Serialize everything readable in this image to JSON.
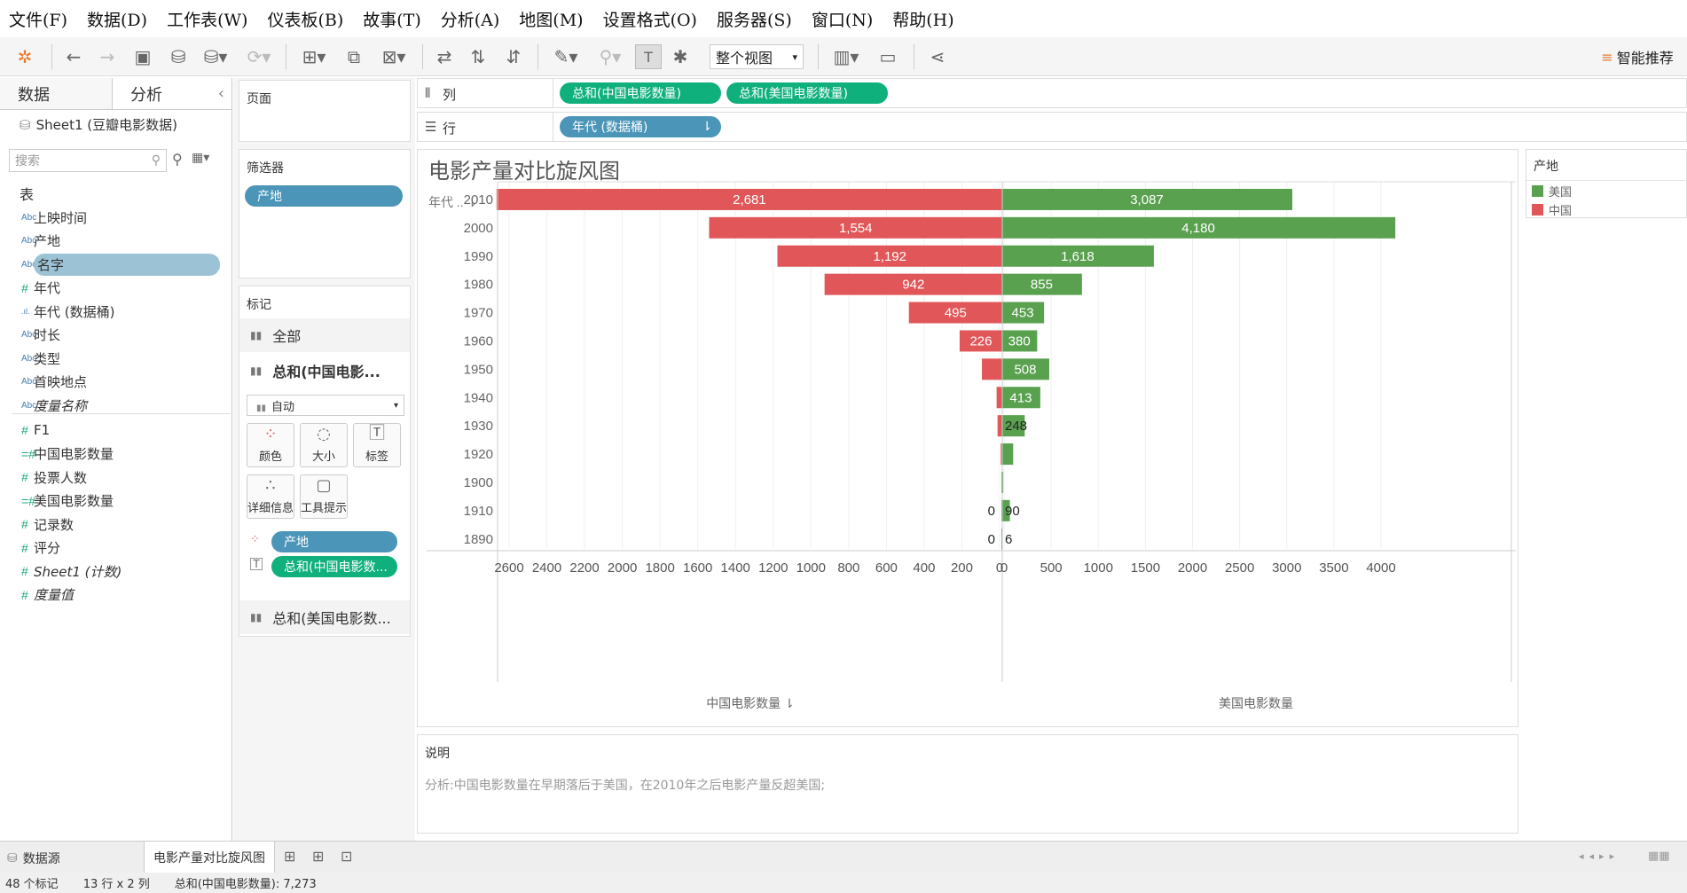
{
  "menu": [
    "文件(F)",
    "数据(D)",
    "工作表(W)",
    "仪表板(B)",
    "故事(T)",
    "分析(A)",
    "地图(M)",
    "设置格式(O)",
    "服务器(S)",
    "窗口(N)",
    "帮助(H)"
  ],
  "toolbar": {
    "view_select": "整个视图",
    "smart_recommend": "智能推荐"
  },
  "left_panel": {
    "tab_data": "数据",
    "tab_analysis": "分析",
    "datasource": "Sheet1 (豆瓣电影数据)",
    "search_placeholder": "搜索",
    "table_header": "表",
    "dimensions": [
      {
        "type": "Abc",
        "name": "上映时间"
      },
      {
        "type": "Abc",
        "name": "产地"
      },
      {
        "type": "Abc",
        "name": "名字"
      },
      {
        "type": "#",
        "name": "年代"
      },
      {
        "type": "bin",
        "name": "年代 (数据桶)"
      },
      {
        "type": "Abc",
        "name": "时长"
      },
      {
        "type": "Abc",
        "name": "类型"
      },
      {
        "type": "Abc",
        "name": "首映地点"
      },
      {
        "type": "Abc",
        "name": "度量名称"
      }
    ],
    "measures": [
      {
        "type": "#",
        "name": "F1"
      },
      {
        "type": "calc",
        "name": "中国电影数量"
      },
      {
        "type": "#",
        "name": "投票人数"
      },
      {
        "type": "calc",
        "name": "美国电影数量"
      },
      {
        "type": "#",
        "name": "记录数"
      },
      {
        "type": "#",
        "name": "评分"
      },
      {
        "type": "#",
        "name": "Sheet1 (计数)"
      },
      {
        "type": "#",
        "name": "度量值"
      }
    ]
  },
  "mid_panel": {
    "pages": "页面",
    "filters": "筛选器",
    "filter_pill": "产地",
    "marks": "标记",
    "marks_all": "全部",
    "marks_cn": "总和(中国电影...",
    "marks_type": "自动",
    "btn_color": "颜色",
    "btn_size": "大小",
    "btn_label": "标签",
    "btn_detail": "详细信息",
    "btn_tooltip": "工具提示",
    "mark_pill_color": "产地",
    "mark_pill_label": "总和(中国电影数...",
    "marks_us": "总和(美国电影数..."
  },
  "shelves": {
    "columns_label": "列",
    "rows_label": "行",
    "col_pill_1": "总和(中国电影数量)",
    "col_pill_2": "总和(美国电影数量)",
    "row_pill": "年代 (数据桶)"
  },
  "legend": {
    "title": "产地",
    "items": [
      {
        "name": "美国",
        "color": "#59a14f"
      },
      {
        "name": "中国",
        "color": "#e15759"
      }
    ]
  },
  "caption": {
    "title": "说明",
    "text": "分析:中国电影数量在早期落后于美国，在2010年之后电影产量反超美国;"
  },
  "chart_data": {
    "type": "bar",
    "title": "电影产量对比旋风图",
    "row_header": "年代 ..",
    "categories": [
      "2010",
      "2000",
      "1990",
      "1980",
      "1970",
      "1960",
      "1950",
      "1940",
      "1930",
      "1920",
      "1900",
      "1910",
      "1890"
    ],
    "series": [
      {
        "name": "中国",
        "values": [
          2681,
          1554,
          1192,
          942,
          495,
          226,
          108,
          30,
          25,
          8,
          0,
          0,
          0
        ],
        "labels": [
          "2,681",
          "1,554",
          "1,192",
          "942",
          "495",
          "226",
          "",
          "",
          "",
          "",
          "",
          "0",
          "0"
        ],
        "color": "#e15759"
      },
      {
        "name": "美国",
        "values": [
          3087,
          4180,
          1618,
          855,
          453,
          380,
          508,
          413,
          248,
          125,
          20,
          90,
          6
        ],
        "labels": [
          "3,087",
          "4,180",
          "1,618",
          "855",
          "453",
          "380",
          "508",
          "413",
          "248",
          "",
          "",
          "90",
          "6"
        ],
        "color": "#59a14f"
      }
    ],
    "left_axis": {
      "label": "中国电影数量",
      "ticks": [
        2600,
        2400,
        2200,
        2000,
        1800,
        1600,
        1400,
        1200,
        1000,
        800,
        600,
        400,
        200,
        0
      ],
      "range": [
        0,
        2700
      ]
    },
    "right_axis": {
      "label": "美国电影数量",
      "ticks": [
        0,
        500,
        1000,
        1500,
        2000,
        2500,
        3000,
        3500,
        4000
      ],
      "range": [
        0,
        4200
      ]
    }
  },
  "bottom_tabs": {
    "datasource": "数据源",
    "sheet": "电影产量对比旋风图"
  },
  "status": {
    "marks": "48 个标记",
    "dims": "13 行 x 2 列",
    "sum": "总和(中国电影数量): 7,273"
  }
}
